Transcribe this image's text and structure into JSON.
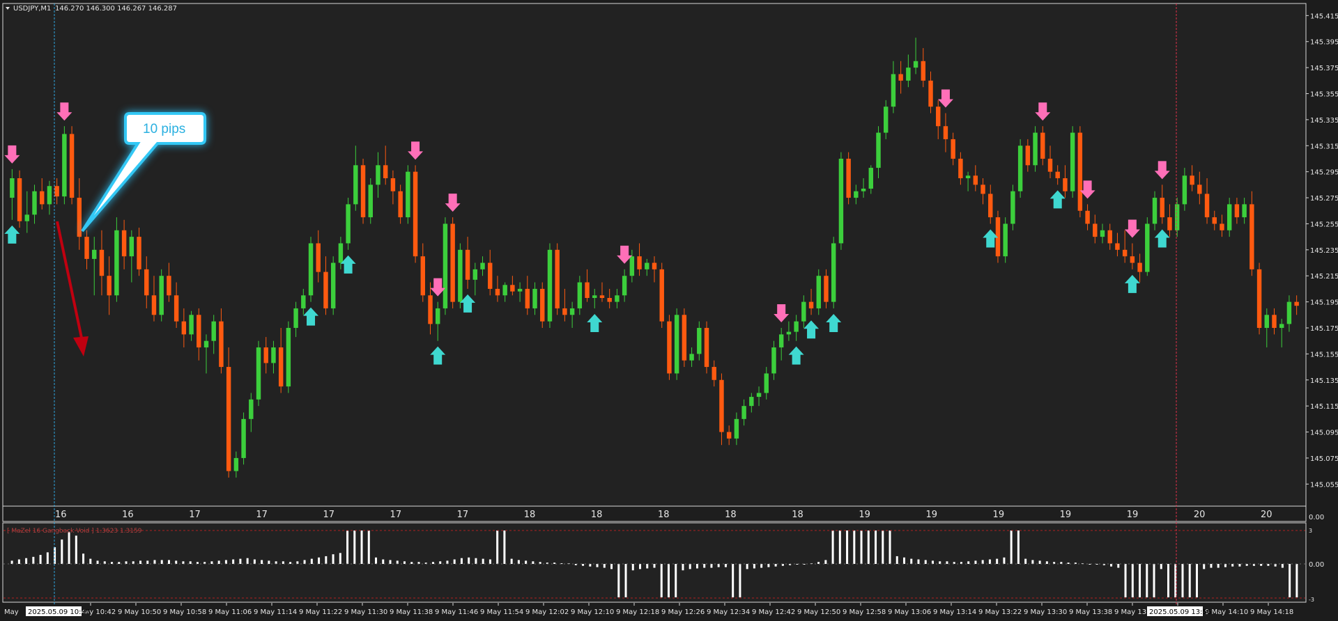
{
  "symbol_info": {
    "symbol": "USDJPY,M1",
    "ohlc": "146.270 146.300 146.267 146.287"
  },
  "indicator": {
    "label": "[ MaZel 16 Gangback Void ] 1.3623 1.3159",
    "axis_top": "3",
    "axis_zero": "0.00",
    "axis_bottom": "-3"
  },
  "callout": {
    "text": "10 pips"
  },
  "middle_strip": {
    "right_label": "0.00"
  },
  "cursor_labels": {
    "left_time": "2025.05.09 10:35",
    "right_time": "2025.05.09 13:56",
    "left_edge": "May"
  },
  "colors": {
    "background": "#1c1c1c",
    "bull": "#3ccf3c",
    "bear": "#ff5a10",
    "up_arrow": "#3fd8d0",
    "down_arrow": "#ff6fb8",
    "grid_border": "#d8d8d8",
    "left_cursor": "#2fa6e0",
    "right_cursor": "#e0304a",
    "callout": "#2ab0e0",
    "drawn_arrow": "#c00010"
  },
  "chart_data": {
    "type": "candlestick",
    "title": "USDJPY,M1",
    "price_axis": {
      "range": [
        145.045,
        145.42
      ],
      "ticks": [
        "145.415",
        "145.395",
        "145.375",
        "145.355",
        "145.335",
        "145.315",
        "145.295",
        "145.275",
        "145.255",
        "145.235",
        "145.215",
        "145.195",
        "145.175",
        "145.155",
        "145.135",
        "145.115",
        "145.095",
        "145.075",
        "145.055"
      ]
    },
    "time_axis": {
      "ticks": [
        "9 May 10:42",
        "9 May 10:50",
        "9 May 10:58",
        "9 May 11:06",
        "9 May 11:14",
        "9 May 11:22",
        "9 May 11:30",
        "9 May 11:38",
        "9 May 11:46",
        "9 May 11:54",
        "9 May 12:02",
        "9 May 12:10",
        "9 May 12:18",
        "9 May 12:26",
        "9 May 12:34",
        "9 May 12:42",
        "9 May 12:50",
        "9 May 12:58",
        "9 May 13:06",
        "9 May 13:14",
        "9 May 13:22",
        "9 May 13:30",
        "9 May 13:38",
        "9 May 13:46",
        "9 May 14:02",
        "9 May 14:10",
        "9 May 14:18"
      ]
    },
    "day_strip": [
      "16",
      "16",
      "17",
      "17",
      "17",
      "17",
      "17",
      "18",
      "18",
      "18",
      "18",
      "18",
      "19",
      "19",
      "19",
      "19",
      "19",
      "20",
      "20"
    ],
    "candles": [
      [
        145.275,
        145.297,
        145.258,
        145.29
      ],
      [
        145.29,
        145.296,
        145.252,
        145.257
      ],
      [
        145.257,
        145.28,
        145.248,
        145.262
      ],
      [
        145.262,
        145.285,
        145.255,
        145.28
      ],
      [
        145.28,
        145.29,
        145.266,
        145.27
      ],
      [
        145.27,
        145.288,
        145.262,
        145.284
      ],
      [
        145.284,
        145.29,
        145.27,
        145.276
      ],
      [
        145.276,
        145.33,
        145.27,
        145.324
      ],
      [
        145.324,
        145.33,
        145.27,
        145.275
      ],
      [
        145.275,
        145.29,
        145.235,
        145.245
      ],
      [
        145.245,
        145.25,
        145.22,
        145.228
      ],
      [
        145.228,
        145.245,
        145.2,
        145.235
      ],
      [
        145.235,
        145.25,
        145.2,
        145.215
      ],
      [
        145.215,
        145.23,
        145.185,
        145.2
      ],
      [
        145.2,
        145.26,
        145.195,
        145.25
      ],
      [
        145.25,
        145.258,
        145.22,
        145.23
      ],
      [
        145.23,
        145.25,
        145.21,
        145.245
      ],
      [
        145.245,
        145.252,
        145.215,
        145.22
      ],
      [
        145.22,
        145.23,
        145.19,
        145.2
      ],
      [
        145.2,
        145.215,
        145.18,
        145.185
      ],
      [
        145.185,
        145.22,
        145.18,
        145.215
      ],
      [
        145.215,
        145.225,
        145.195,
        145.2
      ],
      [
        145.2,
        145.21,
        145.175,
        145.18
      ],
      [
        145.18,
        145.19,
        145.16,
        145.17
      ],
      [
        145.17,
        145.188,
        145.165,
        145.185
      ],
      [
        145.185,
        145.19,
        145.15,
        145.16
      ],
      [
        145.16,
        145.17,
        145.14,
        145.165
      ],
      [
        145.165,
        145.185,
        145.155,
        145.18
      ],
      [
        145.18,
        145.19,
        145.14,
        145.145
      ],
      [
        145.145,
        145.16,
        145.06,
        145.065
      ],
      [
        145.065,
        145.08,
        145.06,
        145.075
      ],
      [
        145.075,
        145.11,
        145.07,
        145.105
      ],
      [
        145.105,
        145.125,
        145.095,
        145.12
      ],
      [
        145.12,
        145.165,
        145.115,
        145.16
      ],
      [
        145.16,
        145.168,
        145.14,
        145.148
      ],
      [
        145.148,
        145.165,
        145.14,
        145.16
      ],
      [
        145.16,
        145.175,
        145.125,
        145.13
      ],
      [
        145.13,
        145.18,
        145.125,
        145.175
      ],
      [
        145.175,
        145.195,
        145.168,
        145.19
      ],
      [
        145.19,
        145.205,
        145.185,
        145.2
      ],
      [
        145.2,
        145.245,
        145.195,
        145.24
      ],
      [
        145.24,
        145.25,
        145.21,
        145.218
      ],
      [
        145.218,
        145.23,
        145.185,
        145.19
      ],
      [
        145.19,
        145.23,
        145.185,
        145.225
      ],
      [
        145.225,
        145.245,
        145.22,
        145.24
      ],
      [
        145.24,
        145.275,
        145.235,
        145.27
      ],
      [
        145.27,
        145.315,
        145.265,
        145.3
      ],
      [
        145.3,
        145.305,
        145.255,
        145.26
      ],
      [
        145.26,
        145.29,
        145.255,
        145.285
      ],
      [
        145.285,
        145.31,
        145.275,
        145.3
      ],
      [
        145.3,
        145.315,
        145.285,
        145.29
      ],
      [
        145.29,
        145.296,
        145.27,
        145.28
      ],
      [
        145.28,
        145.285,
        145.255,
        145.26
      ],
      [
        145.26,
        145.3,
        145.255,
        145.295
      ],
      [
        145.295,
        145.3,
        145.225,
        145.23
      ],
      [
        145.23,
        145.24,
        145.195,
        145.2
      ],
      [
        145.2,
        145.21,
        145.17,
        145.178
      ],
      [
        145.178,
        145.195,
        145.165,
        145.19
      ],
      [
        145.19,
        145.26,
        145.185,
        145.255
      ],
      [
        145.255,
        145.26,
        145.19,
        145.195
      ],
      [
        145.195,
        145.24,
        145.19,
        145.235
      ],
      [
        145.235,
        145.245,
        145.205,
        145.212
      ],
      [
        145.212,
        145.225,
        145.2,
        145.22
      ],
      [
        145.22,
        145.23,
        145.215,
        145.225
      ],
      [
        145.225,
        145.235,
        145.2,
        145.205
      ],
      [
        145.205,
        145.215,
        145.195,
        145.2
      ],
      [
        145.2,
        145.21,
        145.195,
        145.208
      ],
      [
        145.208,
        145.215,
        145.2,
        145.203
      ],
      [
        145.203,
        145.21,
        145.195,
        145.205
      ],
      [
        145.205,
        145.215,
        145.185,
        145.19
      ],
      [
        145.19,
        145.21,
        145.185,
        145.205
      ],
      [
        145.205,
        145.21,
        145.175,
        145.18
      ],
      [
        145.18,
        145.24,
        145.175,
        145.235
      ],
      [
        145.235,
        145.24,
        145.185,
        145.19
      ],
      [
        145.19,
        145.205,
        145.18,
        145.185
      ],
      [
        145.185,
        145.195,
        145.175,
        145.19
      ],
      [
        145.19,
        145.215,
        145.185,
        145.21
      ],
      [
        145.21,
        145.22,
        145.195,
        145.198
      ],
      [
        145.198,
        145.205,
        145.19,
        145.2
      ],
      [
        145.2,
        145.21,
        145.195,
        145.198
      ],
      [
        145.198,
        145.205,
        145.19,
        145.195
      ],
      [
        145.195,
        145.205,
        145.19,
        145.2
      ],
      [
        145.2,
        145.22,
        145.195,
        145.215
      ],
      [
        145.215,
        145.235,
        145.21,
        145.23
      ],
      [
        145.23,
        145.24,
        145.215,
        145.22
      ],
      [
        145.22,
        145.228,
        145.215,
        145.225
      ],
      [
        145.225,
        145.23,
        145.21,
        145.22
      ],
      [
        145.22,
        145.225,
        145.175,
        145.18
      ],
      [
        145.18,
        145.185,
        145.135,
        145.14
      ],
      [
        145.14,
        145.19,
        145.135,
        145.185
      ],
      [
        145.185,
        145.19,
        145.145,
        145.15
      ],
      [
        145.15,
        145.16,
        145.145,
        145.155
      ],
      [
        145.155,
        145.18,
        145.15,
        145.175
      ],
      [
        145.175,
        145.18,
        145.14,
        145.145
      ],
      [
        145.145,
        145.15,
        145.13,
        145.135
      ],
      [
        145.135,
        145.14,
        145.085,
        145.095
      ],
      [
        145.095,
        145.1,
        145.085,
        145.09
      ],
      [
        145.09,
        145.11,
        145.085,
        145.105
      ],
      [
        145.105,
        145.12,
        145.1,
        145.115
      ],
      [
        145.115,
        145.125,
        145.11,
        145.122
      ],
      [
        145.122,
        145.13,
        145.115,
        145.125
      ],
      [
        145.125,
        145.145,
        145.12,
        145.14
      ],
      [
        145.14,
        145.165,
        145.135,
        145.16
      ],
      [
        145.16,
        145.175,
        145.15,
        145.17
      ],
      [
        145.17,
        145.18,
        145.165,
        145.172
      ],
      [
        145.172,
        145.185,
        145.165,
        145.18
      ],
      [
        145.18,
        145.2,
        145.175,
        145.195
      ],
      [
        145.195,
        145.205,
        145.185,
        145.19
      ],
      [
        145.19,
        145.22,
        145.185,
        145.215
      ],
      [
        145.215,
        145.22,
        145.19,
        145.195
      ],
      [
        145.195,
        145.245,
        145.19,
        145.24
      ],
      [
        145.24,
        145.31,
        145.235,
        145.305
      ],
      [
        145.305,
        145.31,
        145.27,
        145.275
      ],
      [
        145.275,
        145.285,
        145.27,
        145.28
      ],
      [
        145.28,
        145.29,
        145.275,
        145.282
      ],
      [
        145.282,
        145.3,
        145.278,
        145.298
      ],
      [
        145.298,
        145.33,
        145.29,
        145.325
      ],
      [
        145.325,
        145.35,
        145.32,
        145.345
      ],
      [
        145.345,
        145.38,
        145.34,
        145.37
      ],
      [
        145.37,
        145.38,
        145.355,
        145.365
      ],
      [
        145.365,
        145.385,
        145.36,
        145.375
      ],
      [
        145.375,
        145.398,
        145.37,
        145.38
      ],
      [
        145.38,
        145.39,
        145.36,
        145.365
      ],
      [
        145.365,
        145.372,
        145.34,
        145.345
      ],
      [
        145.345,
        145.35,
        145.32,
        145.33
      ],
      [
        145.33,
        145.34,
        145.31,
        145.32
      ],
      [
        145.32,
        145.325,
        145.3,
        145.305
      ],
      [
        145.305,
        145.31,
        145.285,
        145.29
      ],
      [
        145.29,
        145.295,
        145.28,
        145.292
      ],
      [
        145.292,
        145.3,
        145.28,
        145.285
      ],
      [
        145.285,
        145.29,
        145.27,
        145.278
      ],
      [
        145.278,
        145.285,
        145.255,
        145.26
      ],
      [
        145.26,
        145.265,
        145.225,
        145.23
      ],
      [
        145.23,
        145.26,
        145.225,
        145.255
      ],
      [
        145.255,
        145.285,
        145.25,
        145.28
      ],
      [
        145.28,
        145.32,
        145.275,
        145.315
      ],
      [
        145.315,
        145.32,
        145.295,
        145.3
      ],
      [
        145.3,
        145.33,
        145.295,
        145.325
      ],
      [
        145.325,
        145.33,
        145.3,
        145.305
      ],
      [
        145.305,
        145.315,
        145.29,
        145.295
      ],
      [
        145.295,
        145.3,
        145.285,
        145.29
      ],
      [
        145.29,
        145.3,
        145.275,
        145.28
      ],
      [
        145.28,
        145.33,
        145.275,
        145.325
      ],
      [
        145.325,
        145.33,
        145.26,
        145.265
      ],
      [
        145.265,
        145.27,
        145.25,
        145.255
      ],
      [
        145.255,
        145.262,
        145.24,
        145.245
      ],
      [
        145.245,
        145.255,
        145.24,
        145.25
      ],
      [
        145.25,
        145.255,
        145.235,
        145.24
      ],
      [
        145.24,
        145.248,
        145.23,
        145.235
      ],
      [
        145.235,
        145.25,
        145.225,
        145.23
      ],
      [
        145.23,
        145.24,
        145.22,
        145.225
      ],
      [
        145.225,
        145.232,
        145.21,
        145.218
      ],
      [
        145.218,
        145.26,
        145.215,
        145.255
      ],
      [
        145.255,
        145.28,
        145.25,
        145.275
      ],
      [
        145.275,
        145.285,
        145.255,
        145.26
      ],
      [
        145.26,
        145.27,
        145.245,
        145.25
      ],
      [
        145.25,
        145.275,
        145.245,
        145.27
      ],
      [
        145.27,
        145.298,
        145.265,
        145.292
      ],
      [
        145.292,
        145.3,
        145.28,
        145.285
      ],
      [
        145.285,
        145.295,
        145.27,
        145.278
      ],
      [
        145.278,
        145.29,
        145.255,
        145.26
      ],
      [
        145.26,
        145.265,
        145.25,
        145.255
      ],
      [
        145.255,
        145.262,
        145.245,
        145.25
      ],
      [
        145.25,
        145.275,
        145.245,
        145.27
      ],
      [
        145.27,
        145.275,
        145.255,
        145.26
      ],
      [
        145.26,
        145.275,
        145.255,
        145.27
      ],
      [
        145.27,
        145.28,
        145.215,
        145.22
      ],
      [
        145.22,
        145.225,
        145.17,
        145.175
      ],
      [
        145.175,
        145.19,
        145.16,
        145.185
      ],
      [
        145.185,
        145.19,
        145.17,
        145.175
      ],
      [
        145.175,
        145.182,
        145.16,
        145.178
      ],
      [
        145.178,
        145.2,
        145.172,
        145.195
      ],
      [
        145.195,
        145.2,
        145.185,
        145.192
      ]
    ],
    "up_arrows_at": [
      0,
      40,
      45,
      57,
      61,
      78,
      105,
      107,
      110,
      131,
      140,
      150,
      154
    ],
    "down_arrows_at": [
      0,
      7,
      54,
      57,
      59,
      82,
      103,
      125,
      138,
      144,
      150,
      154
    ],
    "indicator": {
      "name": "[ MaZel 16 Gangback Void ]",
      "values_shown": [
        1.3623,
        1.3159
      ],
      "range": [
        -3,
        3
      ],
      "bars": [
        0.25,
        0.35,
        0.45,
        0.55,
        0.7,
        0.9,
        1.3,
        1.9,
        2.5,
        2.2,
        0.8,
        0.4,
        0.25,
        0.2,
        0.15,
        0.15,
        0.2,
        0.2,
        0.25,
        0.25,
        0.3,
        0.3,
        0.3,
        0.25,
        0.2,
        0.2,
        0.15,
        0.15,
        0.2,
        0.25,
        0.3,
        0.35,
        0.4,
        0.45,
        0.35,
        0.3,
        0.25,
        0.2,
        0.2,
        0.15,
        0.2,
        0.3,
        0.4,
        0.5,
        0.6,
        0.75,
        0.85,
        2.6,
        2.6,
        2.6,
        2.6,
        0.5,
        0.35,
        0.3,
        0.25,
        0.2,
        0.15,
        0.15,
        0.1,
        0.15,
        0.2,
        0.25,
        0.35,
        0.45,
        0.5,
        0.45,
        0.4,
        0.35,
        2.6,
        2.6,
        0.4,
        0.3,
        0.25,
        0.2,
        0.15,
        0.1,
        0.1,
        0.05,
        0.05,
        -0.1,
        -0.15,
        -0.2,
        -0.25,
        -0.3,
        -0.4,
        -2.6,
        -2.6,
        -0.5,
        -0.4,
        -0.35,
        -0.3,
        -2.6,
        -2.6,
        -2.6,
        -0.5,
        -0.4,
        -0.35,
        -0.3,
        -0.3,
        -0.25,
        -0.25,
        -2.6,
        -2.6,
        -0.4,
        -0.35,
        -0.3,
        -0.25,
        -0.2,
        -0.15,
        -0.1,
        -0.05,
        0.0,
        0.05,
        0.15,
        0.3,
        2.6,
        2.6,
        2.6,
        2.6,
        2.6,
        2.6,
        2.6,
        2.6,
        2.6,
        0.6,
        0.5,
        0.4,
        0.35,
        0.3,
        0.25,
        0.2,
        0.2,
        0.15,
        0.15,
        0.2,
        0.25,
        0.3,
        0.35,
        0.4,
        0.5,
        2.6,
        2.6,
        0.4,
        0.3,
        0.25,
        0.2,
        0.15,
        0.15,
        0.1,
        0.1,
        0.05,
        0.0,
        -0.05,
        -0.1,
        -0.2,
        -0.3,
        -2.6,
        -2.6,
        -2.6,
        -2.6,
        -2.6,
        -0.4,
        -2.6,
        -2.6,
        -2.6,
        -2.6,
        -2.6,
        -0.4,
        -0.3,
        -0.3,
        -0.25,
        -0.2,
        -0.2,
        -0.15,
        -0.15,
        -0.15,
        -0.15,
        -0.2,
        -0.3,
        -2.6,
        -2.6
      ]
    }
  }
}
